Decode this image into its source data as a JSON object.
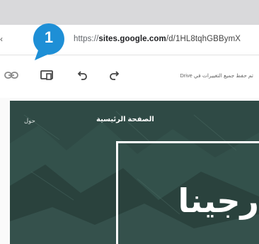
{
  "browser": {
    "url_scheme": "https://",
    "url_domain": "sites.google.com",
    "url_path": "/d/1HL8tqhGBBymX"
  },
  "toolbar": {
    "save_status": "تم حفظ جميع التغييرات في Drive",
    "icons": [
      "link-icon",
      "preview-icon",
      "undo-icon",
      "redo-icon"
    ]
  },
  "callout": {
    "number": "1",
    "color": "#1e8fd6"
  },
  "site": {
    "nav_home": "الصفحة الرئيسية",
    "nav_about": "حول",
    "hero_title": "رجينا",
    "background_color": "#2f4a45"
  }
}
